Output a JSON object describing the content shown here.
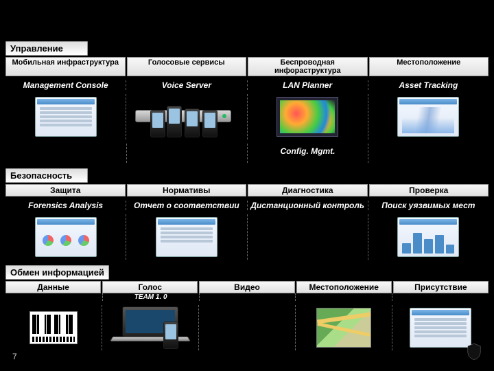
{
  "page_number": "7",
  "sections": {
    "mgmt": {
      "title": "Управление",
      "cols": [
        "Мобильная инфраструктура",
        "Голосовые сервисы",
        "Беспроводная инфораструктура",
        "Местоположение"
      ],
      "subs": [
        "Management Console",
        "Voice Server",
        "LAN Planner",
        "Asset Tracking"
      ],
      "extra_sub": "Config. Mgmt."
    },
    "sec": {
      "title": "Безопасность",
      "cols": [
        "Защита",
        "Нормативы",
        "Диагностика",
        "Проверка"
      ],
      "subs": [
        "Forensics Analysis",
        "Отчет о соответствии",
        "Дистанционный контроль",
        "Поиск уязвимых мест"
      ]
    },
    "comm": {
      "title": "Обмен информацией",
      "cols": [
        "Данные",
        "Голос",
        "Видео",
        "Местоположение",
        "Присутствие"
      ],
      "team_label": "TEAM 1. 0"
    }
  }
}
